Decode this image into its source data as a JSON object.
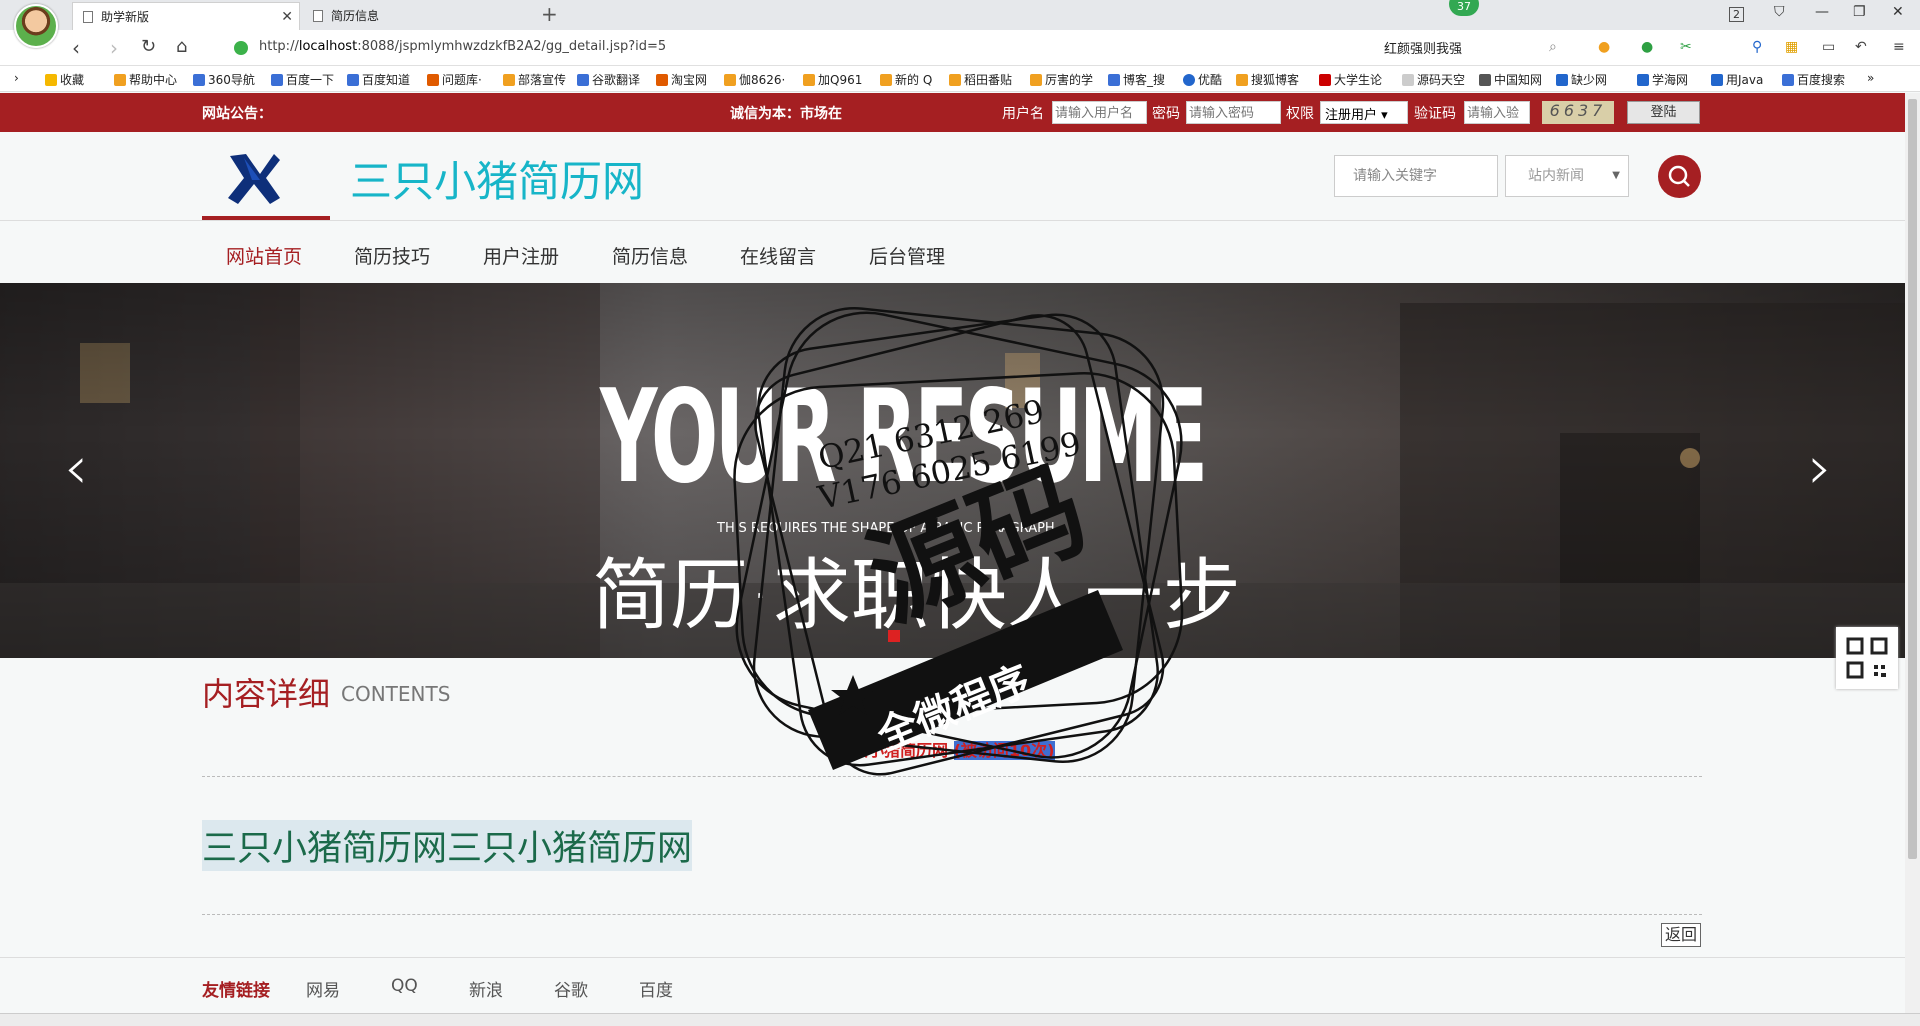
{
  "browser": {
    "tabs": [
      {
        "title": "助学新版"
      },
      {
        "title": "简历信息"
      }
    ],
    "badge_count": "37",
    "window_count": "2",
    "url_prefix": "http://",
    "url_host": "localhost",
    "url_rest": ":8088/jspmlymhwzdzkfB2A2/gg_detail.jsp?id=5",
    "search_text": "红颜强则我强",
    "bookmarks": [
      "收藏",
      "帮助中心",
      "360导航",
      "百度一下",
      "百度知道",
      "问题库·",
      "部落宣传",
      "谷歌翻译",
      "淘宝网",
      "伽8626·",
      "加Q961",
      "新的 Q",
      "稻田番贴",
      "厉害的学",
      "博客_搜",
      "优酷",
      "搜狐博客",
      "大学生论",
      "源码天空",
      "中国知网",
      "缺少网",
      "学海网",
      "用Java",
      "百度搜索"
    ]
  },
  "site": {
    "topbar": {
      "notice_label": "网站公告：",
      "notice_text": "诚信为本：市场在",
      "username_label": "用户名",
      "username_placeholder": "请输入用户名",
      "password_label": "密码",
      "password_placeholder": "请输入密码",
      "role_label": "权限",
      "role_value": "注册用户",
      "captcha_label": "验证码",
      "captcha_placeholder": "请输入验",
      "captcha_image": "6637",
      "login_label": "登陆"
    },
    "header": {
      "site_name": "三只小猪简历网",
      "keyword_placeholder": "请输入关键字",
      "scope_value": "站内新闻"
    },
    "nav": [
      "网站首页",
      "简历技巧",
      "用户注册",
      "简历信息",
      "在线留言",
      "后台管理"
    ],
    "banner": {
      "headline": "YOUR RESUME",
      "small_text": "THIS REQUIRES THE SHAPE OF A BASIC PARAGRAPH",
      "chinese_text": "简历·求职快人一步"
    },
    "content": {
      "title": "内容详细",
      "subtitle": "CONTENTS",
      "meta_site": "三只小猪简历网",
      "meta_views": "(被访问10次)",
      "body": "三只小猪简历网三只小猪简历网",
      "back_label": "返回"
    },
    "footer": {
      "label": "友情链接",
      "links": [
        "网易",
        "QQ",
        "新浪",
        "谷歌",
        "百度"
      ]
    }
  },
  "watermark": {
    "line1": "Q21 6312 269",
    "line2": "V176 6025 6199",
    "main": "源码",
    "ribbon": "全微程序"
  },
  "colors": {
    "brand_red": "#a51f22",
    "site_name_cyan": "#17b5c8",
    "body_green": "#1b6a4a"
  }
}
